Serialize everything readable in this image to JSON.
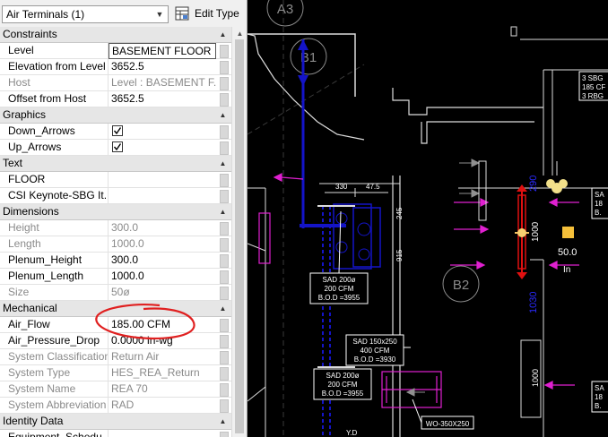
{
  "type_selector": {
    "value": "Air Terminals (1)"
  },
  "edit_type_label": "Edit Type",
  "sections": [
    {
      "title": "Constraints",
      "rows": [
        {
          "label": "Level",
          "value": "BASEMENT FLOOR",
          "disabled": false,
          "editing": true
        },
        {
          "label": "Elevation from Level",
          "value": "3652.5",
          "disabled": false
        },
        {
          "label": "Host",
          "value": "Level : BASEMENT F...",
          "disabled": true
        },
        {
          "label": "Offset from Host",
          "value": "3652.5",
          "disabled": false
        }
      ]
    },
    {
      "title": "Graphics",
      "rows": [
        {
          "label": "Down_Arrows",
          "value": "",
          "checkbox": true,
          "checked": true
        },
        {
          "label": "Up_Arrows",
          "value": "",
          "checkbox": true,
          "checked": true
        }
      ]
    },
    {
      "title": "Text",
      "rows": [
        {
          "label": "FLOOR",
          "value": ""
        },
        {
          "label": "CSI Keynote-SBG It...",
          "value": ""
        }
      ]
    },
    {
      "title": "Dimensions",
      "rows": [
        {
          "label": "Height",
          "value": "300.0",
          "disabled": true
        },
        {
          "label": "Length",
          "value": "1000.0",
          "disabled": true
        },
        {
          "label": "Plenum_Height",
          "value": "300.0"
        },
        {
          "label": "Plenum_Length",
          "value": "1000.0"
        },
        {
          "label": "Size",
          "value": "50ø",
          "disabled": true
        }
      ]
    },
    {
      "title": "Mechanical",
      "rows": [
        {
          "label": "Air_Flow",
          "value": "185.00 CFM",
          "highlight": true
        },
        {
          "label": "Air_Pressure_Drop",
          "value": "0.0000 in-wg"
        },
        {
          "label": "System Classification",
          "value": "Return Air",
          "disabled": true
        },
        {
          "label": "System Type",
          "value": "HES_REA_Return",
          "disabled": true
        },
        {
          "label": "System Name",
          "value": "REA 70",
          "disabled": true
        },
        {
          "label": "System Abbreviation",
          "value": "RAD",
          "disabled": true
        }
      ]
    },
    {
      "title": "Identity Data",
      "rows": [
        {
          "label": "Equipment_Schedu...",
          "value": ""
        }
      ]
    }
  ],
  "drawing": {
    "grid_labels": [
      "A3",
      "B1",
      "B2"
    ],
    "dim_top": [
      "330",
      "47.5"
    ],
    "dim_side": [
      "245",
      "915"
    ],
    "dim_blue": [
      "290",
      "1030"
    ],
    "dim_white_vert": [
      "1000",
      "1000"
    ],
    "tags": [
      {
        "lines": [
          "SAD 200ø",
          "200 CFM",
          "B.O.D =3955"
        ]
      },
      {
        "lines": [
          "SAD 150x250",
          "400 CFM",
          "B.O.D =3930"
        ]
      },
      {
        "lines": [
          "SAD 200ø",
          "200 CFM",
          "B.O.D =3955"
        ]
      },
      {
        "lines": [
          "WO-350X250"
        ]
      }
    ],
    "tag_top_right": [
      "3 SBG",
      "185 CF",
      "3 RBG"
    ],
    "tag_right_mid": [
      "SA",
      "18",
      "B."
    ],
    "tag_right_bottom": [
      "SA",
      "18",
      "B."
    ],
    "value_label": "50.0",
    "unit_label": "In",
    "bottom_label": "Y.D"
  },
  "colors": {
    "panel_bg": "#ffffff",
    "header_bg": "#e6e6e6",
    "cad_bg": "#000000",
    "duct_blue": "#1414c8",
    "magenta": "#e020d0",
    "red": "#e01010",
    "annotation_red": "#e02020"
  }
}
